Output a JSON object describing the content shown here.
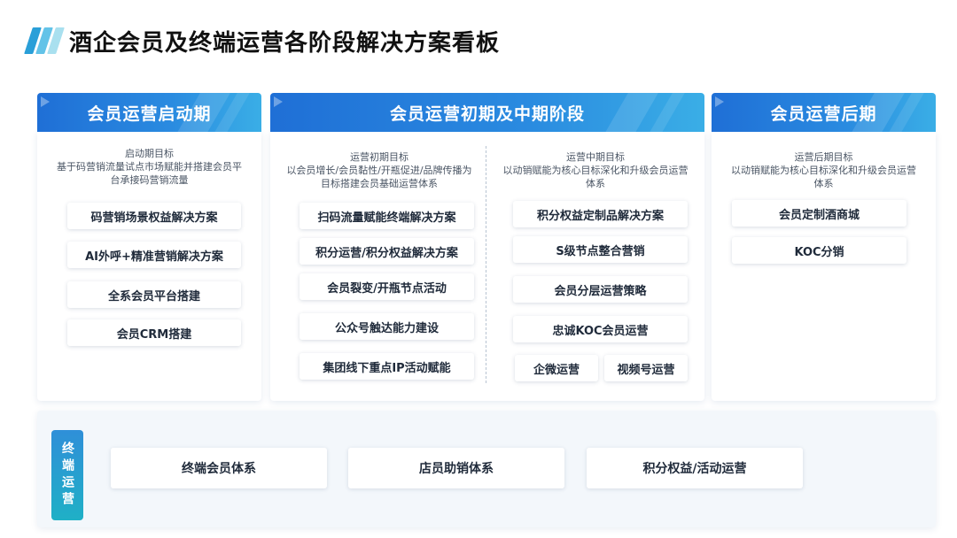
{
  "title": "酒企会员及终端运营各阶段解决方案看板",
  "colors": {
    "accent_blue": "#1f6fd6",
    "accent_cyan": "#1fb0c6"
  },
  "stage1": {
    "header": "会员运营启动期",
    "goal_title": "启动期目标",
    "goal_line1": "基于码营销流量试点市场赋能并搭建会员平",
    "goal_line2": "台承接码营销流量",
    "cards": [
      "码营销场景权益解决方案",
      "AI外呼+精准营销解决方案",
      "全系会员平台搭建",
      "会员CRM搭建"
    ]
  },
  "stage2": {
    "header": "会员运营初期及中期阶段",
    "early": {
      "goal_title": "运营初期目标",
      "goal_line1": "以会员增长/会员黏性/开瓶促进/品牌传播为",
      "goal_line2": "目标搭建会员基础运营体系",
      "cards": [
        "扫码流量赋能终端解决方案",
        "积分运营/积分权益解决方案",
        "会员裂变/开瓶节点活动",
        "公众号触达能力建设",
        "集团线下重点IP活动赋能"
      ]
    },
    "mid": {
      "goal_title": "运营中期目标",
      "goal_line1": "以动销赋能为核心目标深化和升级会员运营",
      "goal_line2": "体系",
      "cards": [
        "积分权益定制品解决方案",
        "S级节点整合营销",
        "会员分层运营策略",
        "忠诚KOC会员运营",
        "企微运营",
        "视频号运营"
      ]
    }
  },
  "stage3": {
    "header": "会员运营后期",
    "goal_title": "运营后期目标",
    "goal_line1": "以动销赋能为核心目标深化和升级会员运营",
    "goal_line2": "体系",
    "cards": [
      "会员定制酒商城",
      "KOC分销"
    ]
  },
  "terminal": {
    "tag": "终端运营",
    "cards": [
      "终端会员体系",
      "店员助销体系",
      "积分权益/活动运营"
    ]
  }
}
